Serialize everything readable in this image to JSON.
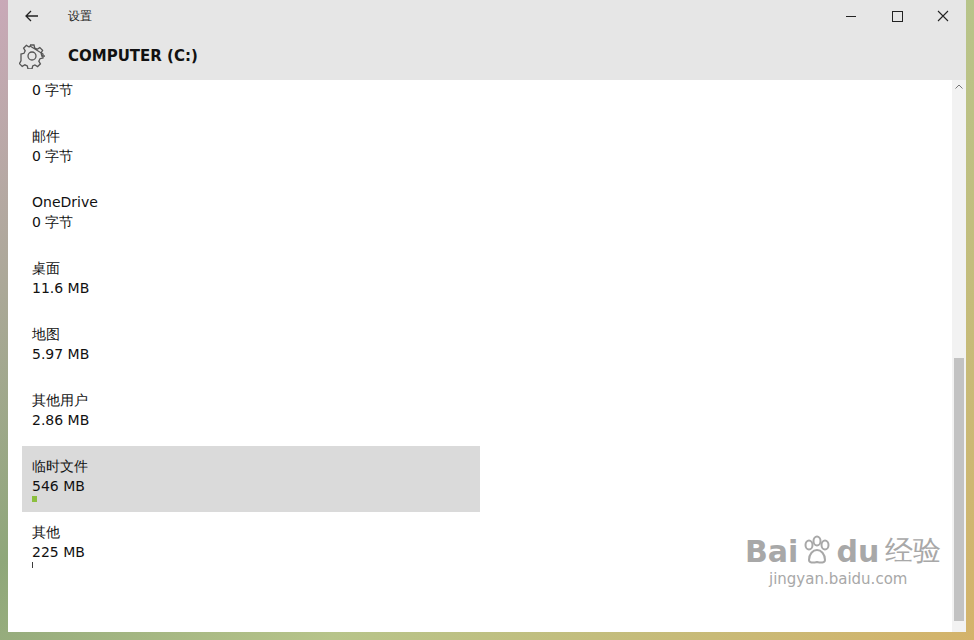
{
  "window": {
    "title": "设置",
    "heading": "COMPUTER (C:)"
  },
  "items": [
    {
      "size": "0 字节",
      "level": 0,
      "selected": false,
      "color": "#8cbf3f"
    },
    {
      "label": "邮件",
      "size": "0 字节",
      "level": 0,
      "selected": false,
      "color": "#8cbf3f"
    },
    {
      "label": "OneDrive",
      "size": "0 字节",
      "level": 0,
      "selected": false,
      "color": "#8cbf3f"
    },
    {
      "label": "桌面",
      "size": "11.6 MB",
      "level": 0,
      "selected": false,
      "color": "#8cbf3f"
    },
    {
      "label": "地图",
      "size": "5.97 MB",
      "level": 0,
      "selected": false,
      "color": "#8cbf3f"
    },
    {
      "label": "其他用户",
      "size": "2.86 MB",
      "level": 0,
      "selected": false,
      "color": "#8cbf3f"
    },
    {
      "label": "临时文件",
      "size": "546 MB",
      "level": 0.011,
      "selected": true,
      "color": "#8cbf3f"
    },
    {
      "label": "其他",
      "size": "225 MB",
      "level": 0.003,
      "selected": false,
      "color": "#3c3c3c"
    }
  ],
  "scrollbar": {
    "thumb_start": 0.49,
    "thumb_size": 0.49
  },
  "watermark": {
    "brand_left": "Bai",
    "brand_right": "du",
    "product": "经验",
    "url": "jingyan.baidu.com"
  }
}
